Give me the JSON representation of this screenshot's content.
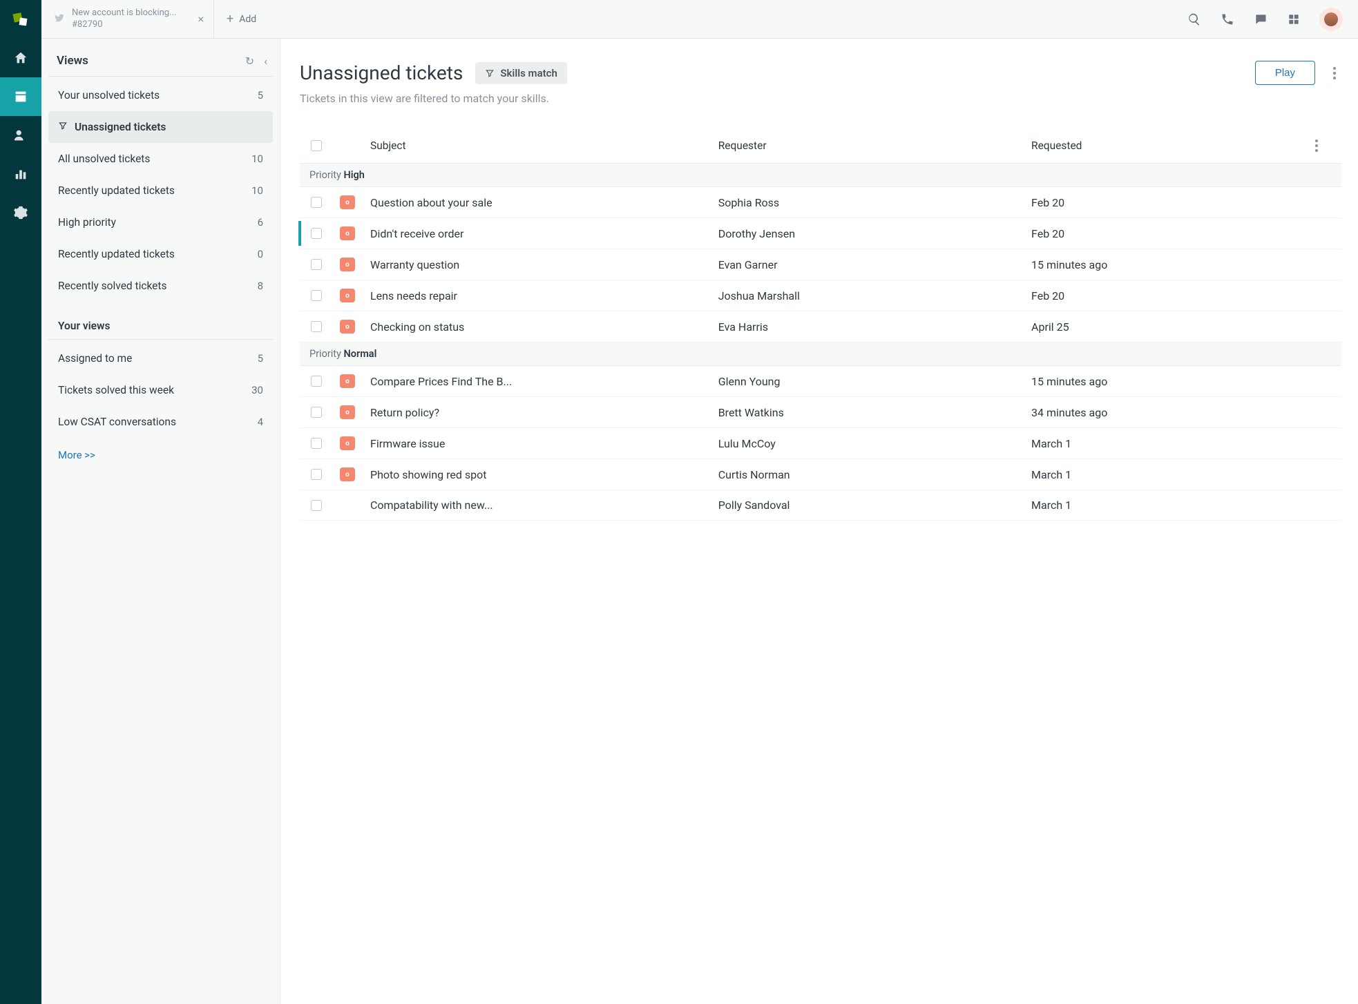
{
  "topbar": {
    "tab": {
      "title": "New account is blocking...",
      "subtitle": "#82790"
    },
    "add_label": "Add"
  },
  "views": {
    "header": "Views",
    "system": [
      {
        "label": "Your unsolved tickets",
        "count": "5",
        "active": false,
        "icon": false
      },
      {
        "label": "Unassigned tickets",
        "count": "",
        "active": true,
        "icon": true
      },
      {
        "label": "All unsolved tickets",
        "count": "10",
        "active": false,
        "icon": false
      },
      {
        "label": "Recently updated tickets",
        "count": "10",
        "active": false,
        "icon": false
      },
      {
        "label": "High priority",
        "count": "6",
        "active": false,
        "icon": false
      },
      {
        "label": "Recently updated tickets",
        "count": "0",
        "active": false,
        "icon": false
      },
      {
        "label": "Recently solved tickets",
        "count": "8",
        "active": false,
        "icon": false
      }
    ],
    "your_views_label": "Your views",
    "personal": [
      {
        "label": "Assigned to me",
        "count": "5"
      },
      {
        "label": "Tickets solved this week",
        "count": "30"
      },
      {
        "label": "Low CSAT conversations",
        "count": "4"
      }
    ],
    "more_label": "More >>"
  },
  "main": {
    "title": "Unassigned tickets",
    "skills_chip": "Skills match",
    "play_label": "Play",
    "subtitle": "Tickets in this view are filtered to match your skills.",
    "columns": {
      "subject": "Subject",
      "requester": "Requester",
      "requested": "Requested"
    },
    "group_label": "Priority",
    "groups": [
      {
        "name": "High",
        "rows": [
          {
            "subject": "Question about your sale",
            "requester": "Sophia Ross",
            "requested": "Feb 20",
            "chip": true,
            "current": false
          },
          {
            "subject": "Didn't receive order",
            "requester": "Dorothy Jensen",
            "requested": "Feb 20",
            "chip": true,
            "current": true
          },
          {
            "subject": "Warranty question",
            "requester": "Evan Garner",
            "requested": "15 minutes ago",
            "chip": true,
            "current": false
          },
          {
            "subject": "Lens needs repair",
            "requester": "Joshua Marshall",
            "requested": "Feb 20",
            "chip": true,
            "current": false
          },
          {
            "subject": "Checking on status",
            "requester": "Eva Harris",
            "requested": "April 25",
            "chip": true,
            "current": false
          }
        ]
      },
      {
        "name": "Normal",
        "rows": [
          {
            "subject": "Compare Prices Find The B...",
            "requester": "Glenn Young",
            "requested": "15 minutes ago",
            "chip": true,
            "current": false
          },
          {
            "subject": "Return policy?",
            "requester": "Brett Watkins",
            "requested": "34 minutes ago",
            "chip": true,
            "current": false
          },
          {
            "subject": "Firmware issue",
            "requester": "Lulu McCoy",
            "requested": "March 1",
            "chip": true,
            "current": false
          },
          {
            "subject": "Photo showing red spot",
            "requester": "Curtis Norman",
            "requested": "March 1",
            "chip": true,
            "current": false
          },
          {
            "subject": "Compatability with new...",
            "requester": "Polly Sandoval",
            "requested": "March 1",
            "chip": false,
            "current": false
          }
        ]
      }
    ]
  }
}
